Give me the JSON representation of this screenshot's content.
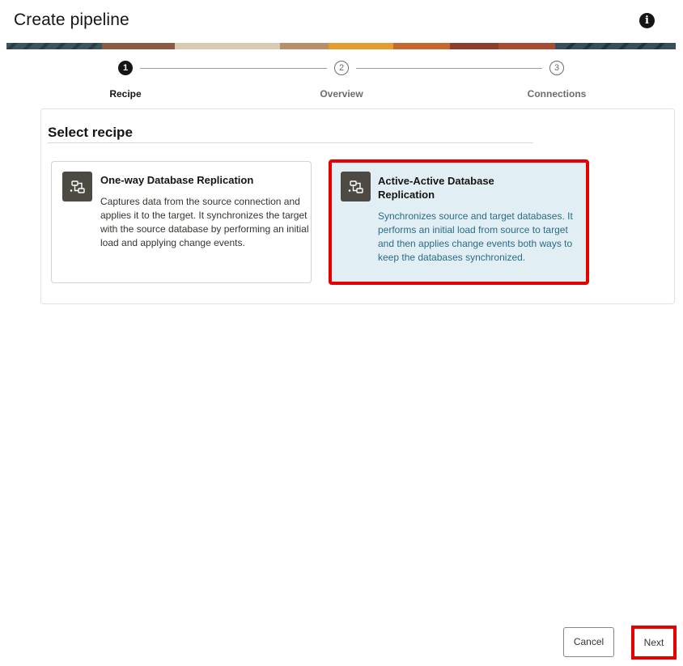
{
  "dialog": {
    "title": "Create pipeline",
    "info_icon": "info-icon"
  },
  "stepper": {
    "steps": [
      {
        "number": "1",
        "label": "Recipe",
        "state": "active"
      },
      {
        "number": "2",
        "label": "Overview",
        "state": "inactive"
      },
      {
        "number": "3",
        "label": "Connections",
        "state": "inactive"
      }
    ]
  },
  "main": {
    "section_title": "Select recipe",
    "recipes": [
      {
        "title": "One-way Database Replication",
        "description": "Captures data from the source connection and applies it to the target. It synchronizes the target with the source database by performing an initial load and applying change events.",
        "icon": "pipeline-icon",
        "selected": false
      },
      {
        "title": "Active-Active Database Replication",
        "description": "Synchronizes source and target databases. It performs an initial load from source to target and then applies change events both ways to keep the databases synchronized.",
        "icon": "pipeline-icon",
        "selected": true
      }
    ]
  },
  "footer": {
    "cancel_label": "Cancel",
    "next_label": "Next"
  },
  "colors": {
    "highlight": "#e60000",
    "selected_card_bg": "#e1eff5",
    "selected_text": "#2b6b86"
  }
}
